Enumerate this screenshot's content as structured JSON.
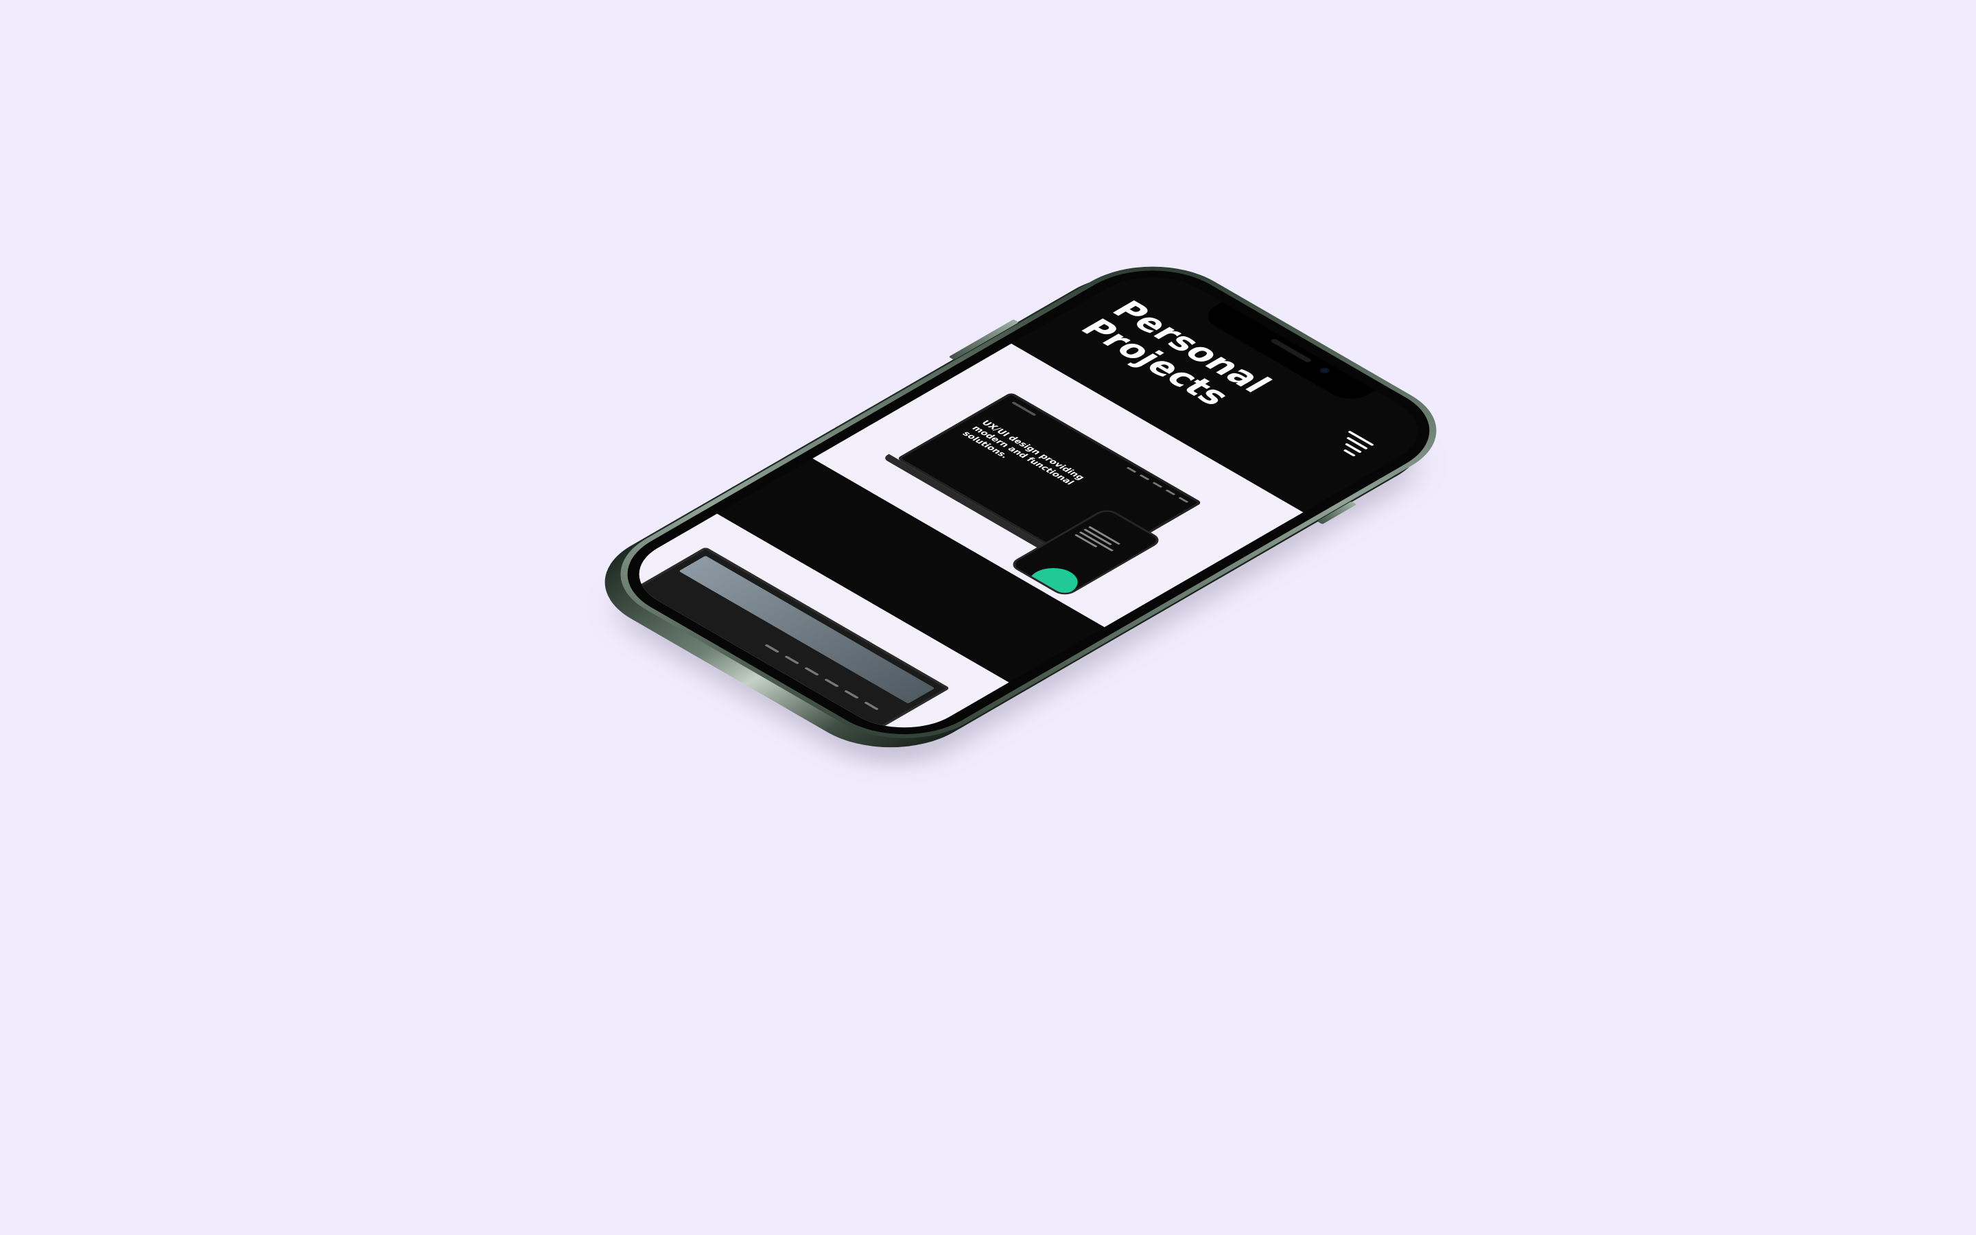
{
  "background_color": "#f1ecfd",
  "phone": {
    "frame_color": "#3f4e44",
    "screen_color": "#0a0a0a"
  },
  "page": {
    "title_line1": "Personal",
    "title_line2": "Projects",
    "menu_icon": "hamburger-menu-icon"
  },
  "projects": [
    {
      "hero_text": "UX/UI design providing modern and functional solutions.",
      "accent_color": "#20c997"
    },
    {
      "hero_text": ""
    }
  ]
}
